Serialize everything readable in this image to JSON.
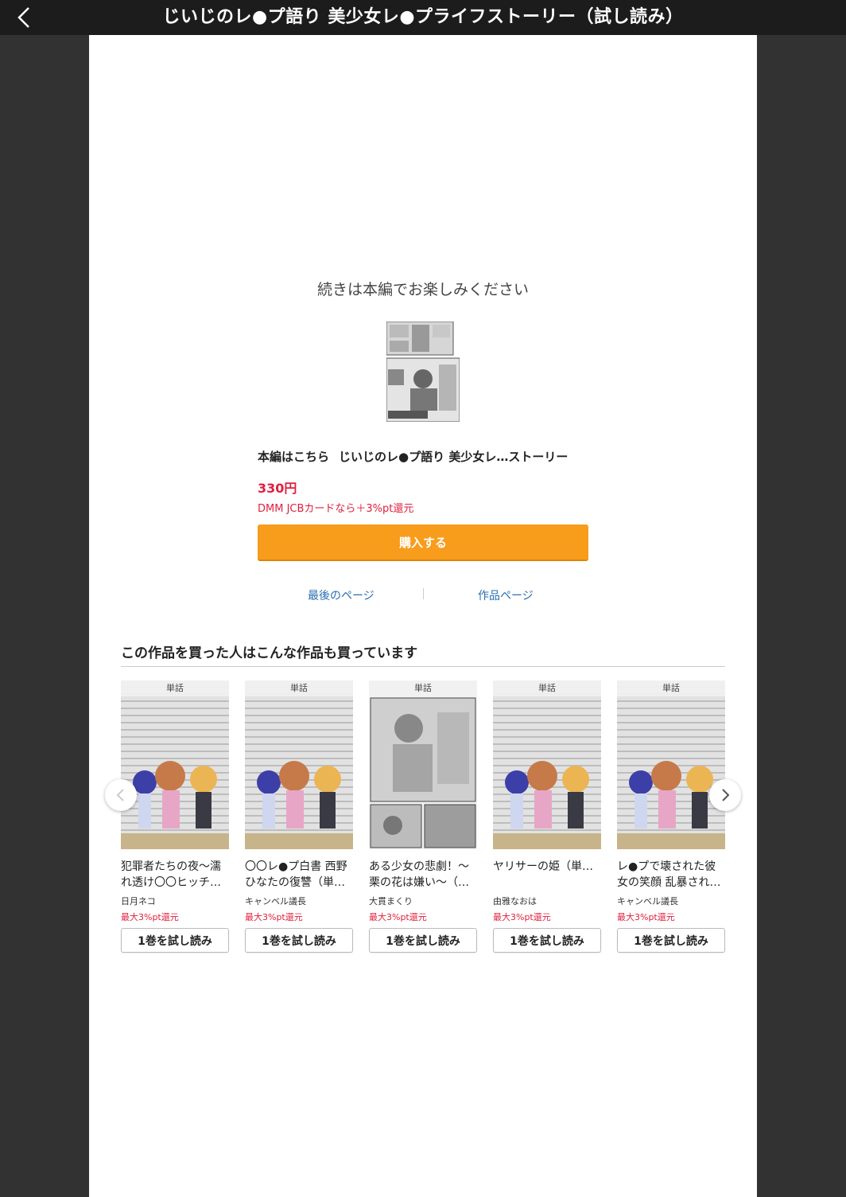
{
  "header": {
    "title": "じいじのレ●プ語り 美少女レ●プライフストーリー（試し読み）"
  },
  "end_panel": {
    "message": "続きは本編でお楽しみください",
    "main_link_label": "本編はこちら",
    "main_link_title": "じいじのレ●プ語り 美少女レ…ストーリー",
    "price": "330円",
    "point_note": "DMM JCBカードなら＋3%pt還元",
    "buy_label": "購入する",
    "last_page_label": "最後のページ",
    "work_page_label": "作品ページ"
  },
  "recommend": {
    "heading": "この作品を買った人はこんな作品も買っています",
    "items": [
      {
        "badge": "単話",
        "title": "犯罪者たちの夜〜濡れ透け〇〇ヒッチ…",
        "author": "日月ネコ",
        "points": "最大3%pt還元",
        "button": "1巻を試し読み"
      },
      {
        "badge": "単話",
        "title": "〇〇レ●プ白書 西野ひなたの復讐（単…",
        "author": "キャンベル議長",
        "points": "最大3%pt還元",
        "button": "1巻を試し読み"
      },
      {
        "badge": "単話",
        "title": "ある少女の悲劇！〜栗の花は嫌い〜（…",
        "author": "大貫まくり",
        "points": "最大3%pt還元",
        "button": "1巻を試し読み"
      },
      {
        "badge": "単話",
        "title": "ヤリサーの姫（単…",
        "author": "由雅なおは",
        "points": "最大3%pt還元",
        "button": "1巻を試し読み"
      },
      {
        "badge": "単話",
        "title": "レ●プで壊された彼女の笑顔 乱暴され…",
        "author": "キャンベル議長",
        "points": "最大3%pt還元",
        "button": "1巻を試し読み"
      }
    ]
  },
  "colors": {
    "accent": "#f89c1c",
    "price": "#e0203e",
    "link": "#2a6fb0"
  },
  "icons": {
    "back": "chevron-left-icon",
    "prev": "chevron-left-icon",
    "next": "chevron-right-icon"
  }
}
